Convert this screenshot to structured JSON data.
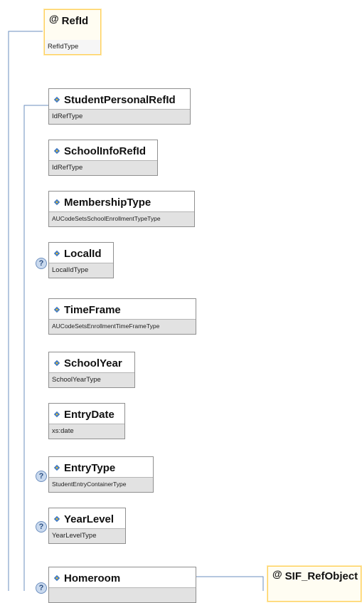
{
  "attribute_nodes": [
    {
      "name": "RefId",
      "type": "RefIdType"
    },
    {
      "name": "SIF_RefObject",
      "type": ""
    }
  ],
  "elements": [
    {
      "name": "StudentPersonalRefId",
      "type": "IdRefType",
      "optional": false
    },
    {
      "name": "SchoolInfoRefId",
      "type": "IdRefType",
      "optional": false
    },
    {
      "name": "MembershipType",
      "type": "AUCodeSetsSchoolEnrollmentTypeType",
      "optional": false
    },
    {
      "name": "LocalId",
      "type": "LocalIdType",
      "optional": true
    },
    {
      "name": "TimeFrame",
      "type": "AUCodeSetsEnrollmentTimeFrameType",
      "optional": false
    },
    {
      "name": "SchoolYear",
      "type": "SchoolYearType",
      "optional": false
    },
    {
      "name": "EntryDate",
      "type": "xs:date",
      "optional": false
    },
    {
      "name": "EntryType",
      "type": "StudentEntryContainerType",
      "optional": true
    },
    {
      "name": "YearLevel",
      "type": "YearLevelType",
      "optional": true
    },
    {
      "name": "Homeroom",
      "type": "",
      "optional": true
    }
  ],
  "icons": {
    "optional": "question-icon",
    "element": "element-icon",
    "attribute": "at-icon"
  },
  "colors": {
    "attribute_border": "#ffd060",
    "type_band": "#e2e2e2",
    "connector": "#6b8fbf",
    "element_icon": "#4a7fc0"
  }
}
